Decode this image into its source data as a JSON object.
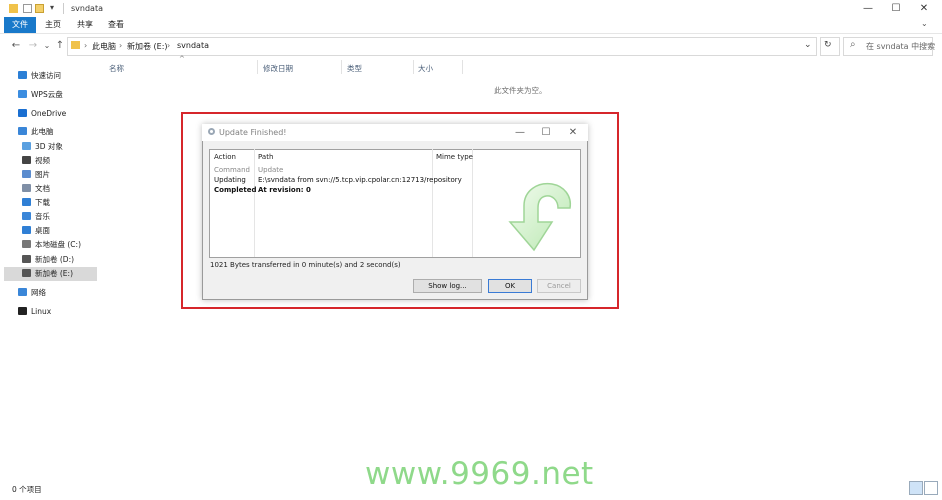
{
  "window": {
    "title": "svndata",
    "minimize": "—",
    "maximize": "☐",
    "close": "✕"
  },
  "ribbon": {
    "tabs": [
      "文件",
      "主页",
      "共享",
      "查看"
    ]
  },
  "address": {
    "back": "←",
    "forward": "→",
    "dropdown": "⌄",
    "up": "↑",
    "crumbs": [
      "此电脑",
      "新加卷 (E:)",
      "svndata"
    ],
    "chevron": "›",
    "refresh": "↻",
    "search_placeholder": "在 svndata 中搜索",
    "search_icon": "⌕"
  },
  "sidebar": {
    "items": [
      {
        "label": "快速访问",
        "icon": "star-icon",
        "color": "#2b7fd6"
      },
      {
        "label": "WPS云盘",
        "icon": "cloud-icon",
        "color": "#3b8de0"
      },
      {
        "label": "OneDrive",
        "icon": "onedrive-icon",
        "color": "#1a6fd1"
      },
      {
        "label": "此电脑",
        "icon": "computer-icon",
        "color": "#3a86d8"
      },
      {
        "label": "3D 对象",
        "icon": "cube-icon",
        "color": "#5aa0e0"
      },
      {
        "label": "视频",
        "icon": "video-icon",
        "color": "#444444"
      },
      {
        "label": "图片",
        "icon": "picture-icon",
        "color": "#5b8ccf"
      },
      {
        "label": "文档",
        "icon": "document-icon",
        "color": "#7f8fa6"
      },
      {
        "label": "下载",
        "icon": "download-icon",
        "color": "#2f7fd5"
      },
      {
        "label": "音乐",
        "icon": "music-icon",
        "color": "#3a86d8"
      },
      {
        "label": "桌面",
        "icon": "desktop-icon",
        "color": "#2f7fd5"
      },
      {
        "label": "本地磁盘 (C:)",
        "icon": "drive-icon",
        "color": "#777777"
      },
      {
        "label": "新加卷 (D:)",
        "icon": "drive-icon",
        "color": "#555555"
      },
      {
        "label": "新加卷 (E:)",
        "icon": "drive-icon",
        "color": "#555555"
      },
      {
        "label": "网络",
        "icon": "network-icon",
        "color": "#3a86d8"
      },
      {
        "label": "Linux",
        "icon": "linux-icon",
        "color": "#222222"
      }
    ]
  },
  "columns": {
    "name": "名称",
    "modified": "修改日期",
    "type": "类型",
    "size": "大小",
    "sort_arrow": "^"
  },
  "empty_message": "此文件夹为空。",
  "status": {
    "items": "0 个项目"
  },
  "dialog": {
    "title": "Update Finished!",
    "headers": {
      "action": "Action",
      "path": "Path",
      "mime": "Mime type"
    },
    "rows": [
      {
        "action": "Command",
        "path": "Update",
        "style": "muted"
      },
      {
        "action": "Updating",
        "path": "E:\\svndata from svn://5.tcp.vip.cpolar.cn:12713/repository",
        "style": "normal"
      },
      {
        "action": "Completed",
        "path": "At revision: 0",
        "style": "bold"
      }
    ],
    "info": "1021 Bytes transferred in 0 minute(s) and 2 second(s)",
    "buttons": {
      "show_log": "Show log...",
      "ok": "OK",
      "cancel": "Cancel"
    }
  },
  "watermark": "www.9969.net",
  "colors": {
    "file_tab": "#1979ca",
    "highlight_border": "#d6262b",
    "watermark": "#8fd98a",
    "column_header": "#4c607a"
  }
}
